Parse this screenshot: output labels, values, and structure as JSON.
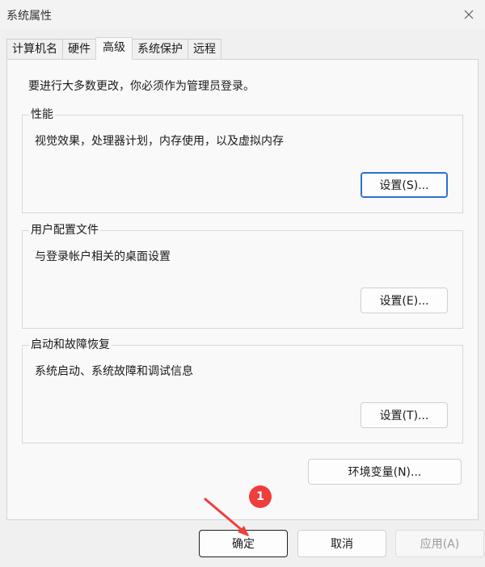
{
  "window": {
    "title": "系统属性"
  },
  "tabs": [
    {
      "label": "计算机名"
    },
    {
      "label": "硬件"
    },
    {
      "label": "高级"
    },
    {
      "label": "系统保护"
    },
    {
      "label": "远程"
    }
  ],
  "active_tab": "高级",
  "panel": {
    "admin_note": "要进行大多数更改，你必须作为管理员登录。",
    "performance": {
      "title": "性能",
      "description": "视觉效果，处理器计划，内存使用，以及虚拟内存",
      "button": "设置(S)..."
    },
    "user_profiles": {
      "title": "用户配置文件",
      "description": "与登录帐户相关的桌面设置",
      "button": "设置(E)..."
    },
    "startup_recovery": {
      "title": "启动和故障恢复",
      "description": "系统启动、系统故障和调试信息",
      "button": "设置(T)..."
    },
    "env_button": "环境变量(N)..."
  },
  "footer": {
    "ok": "确定",
    "cancel": "取消",
    "apply": "应用(A)"
  },
  "annotation": {
    "badge": "1",
    "color": "#ef3e3e"
  }
}
